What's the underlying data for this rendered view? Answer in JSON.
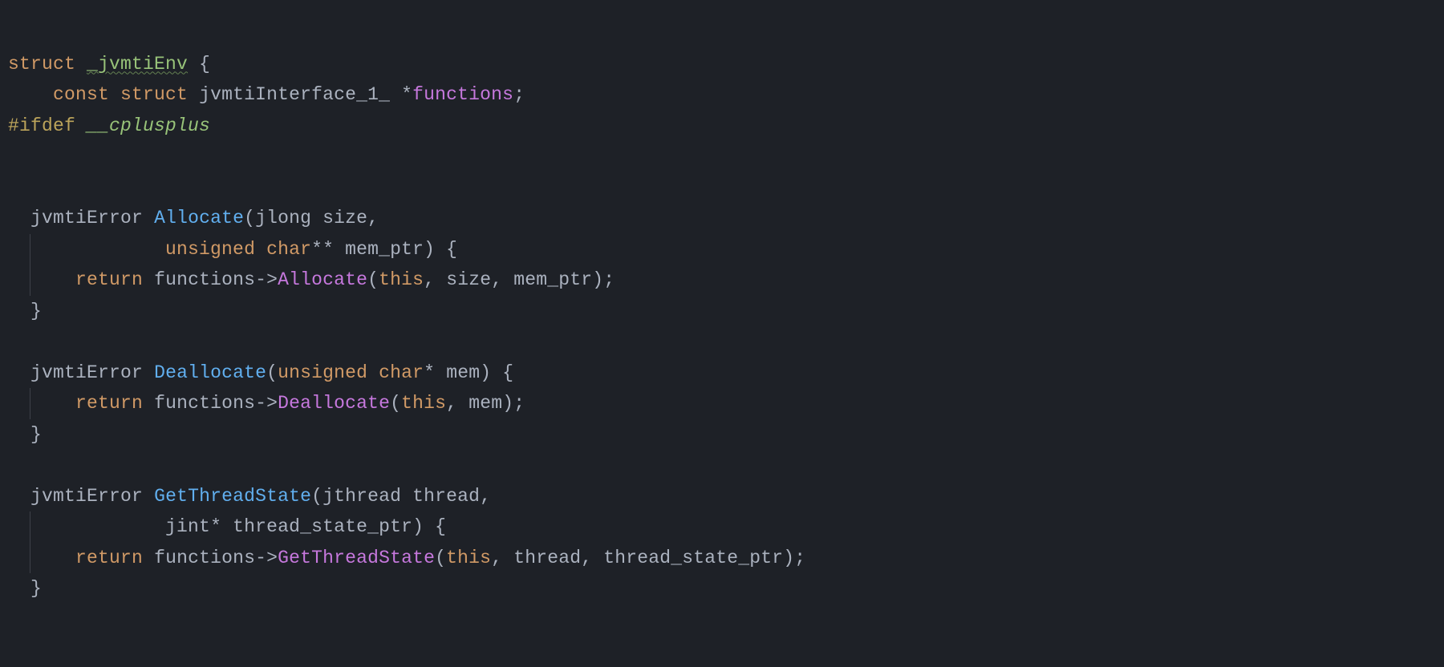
{
  "code": {
    "line1": {
      "kw_struct": "struct",
      "name": "_jvmtiEnv",
      "brace": " {"
    },
    "line2": {
      "indent": "    ",
      "kw_const": "const",
      "kw_struct": "struct",
      "type": "jvmtiInterface_1_",
      "star": "*",
      "member": "functions",
      "semi": ";"
    },
    "line3": {
      "hash_ifdef": "#ifdef",
      "macro": "__cplusplus"
    },
    "alloc": {
      "indent": "  ",
      "ret_type": "jvmtiError",
      "name": "Allocate",
      "p1_type": "jlong",
      "p1_name": "size",
      "cont_indent": "            ",
      "p2_unsigned": "unsigned",
      "p2_char": "char",
      "p2_stars": "**",
      "p2_name": "mem_ptr",
      "close_paren_brace": ") {",
      "body_indent": "    ",
      "kw_return": "return",
      "obj": "functions",
      "arrow": "->",
      "call": "Allocate",
      "this": "this",
      "arg1": "size",
      "arg2": "mem_ptr",
      "end": ");",
      "close": "}"
    },
    "dealloc": {
      "indent": "  ",
      "ret_type": "jvmtiError",
      "name": "Deallocate",
      "p1_unsigned": "unsigned",
      "p1_char": "char",
      "p1_star": "*",
      "p1_name": "mem",
      "close_paren_brace": ") {",
      "body_indent": "    ",
      "kw_return": "return",
      "obj": "functions",
      "arrow": "->",
      "call": "Deallocate",
      "this": "this",
      "arg1": "mem",
      "end": ");",
      "close": "}"
    },
    "gts": {
      "indent": "  ",
      "ret_type": "jvmtiError",
      "name": "GetThreadState",
      "p1_type": "jthread",
      "p1_name": "thread",
      "cont_indent": "            ",
      "p2_type": "jint",
      "p2_star": "*",
      "p2_name": "thread_state_ptr",
      "close_paren_brace": ") {",
      "body_indent": "    ",
      "kw_return": "return",
      "obj": "functions",
      "arrow": "->",
      "call": "GetThreadState",
      "this": "this",
      "arg1": "thread",
      "arg2": "thread_state_ptr",
      "end": ");",
      "close": "}"
    }
  }
}
